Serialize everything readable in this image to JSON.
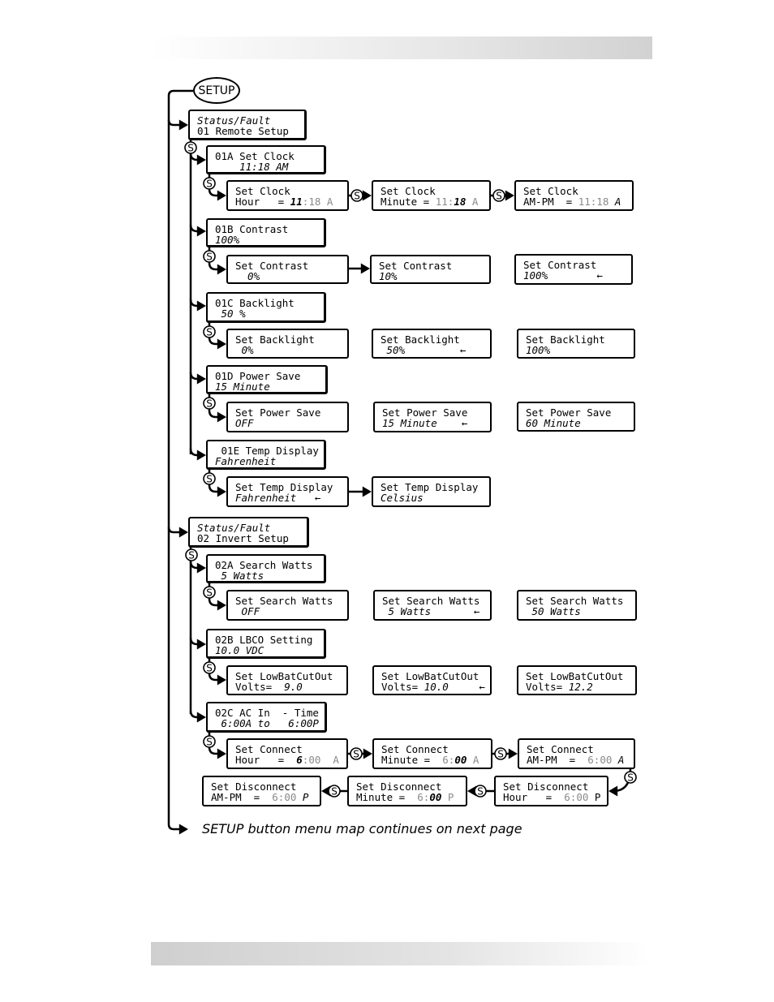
{
  "setup_button": "SETUP",
  "s_label": "S",
  "footer_note": "SETUP button menu map continues on next page",
  "boxes": {
    "status1": [
      [
        [
          "Status/Fault",
          "i"
        ]
      ],
      [
        [
          "01 Remote Setup",
          ""
        ]
      ]
    ],
    "b01A": [
      [
        [
          "01A Set Clock",
          ""
        ]
      ],
      [
        [
          "    11:18 AM",
          "i"
        ]
      ]
    ],
    "clk1": [
      [
        [
          "Set Clock",
          ""
        ]
      ],
      [
        [
          "Hour   = ",
          ""
        ],
        [
          "11",
          "ib"
        ],
        [
          ":18 A",
          "g"
        ]
      ]
    ],
    "clk2": [
      [
        [
          "Set Clock",
          ""
        ]
      ],
      [
        [
          "Minute = ",
          ""
        ],
        [
          "11:",
          "g"
        ],
        [
          "18",
          "ib"
        ],
        [
          " A",
          "g"
        ]
      ]
    ],
    "clk3": [
      [
        [
          "Set Clock",
          ""
        ]
      ],
      [
        [
          "AM-PM  = ",
          ""
        ],
        [
          "11:18 ",
          "g"
        ],
        [
          "A",
          "i"
        ]
      ]
    ],
    "b01B": [
      [
        [
          "01B Contrast",
          ""
        ]
      ],
      [
        [
          "100%",
          "i"
        ]
      ]
    ],
    "con1": [
      [
        [
          "Set Contrast",
          ""
        ]
      ],
      [
        [
          "  0%",
          "i"
        ]
      ]
    ],
    "con2": [
      [
        [
          "Set Contrast",
          ""
        ]
      ],
      [
        [
          "10%",
          "i"
        ]
      ]
    ],
    "con3": [
      [
        [
          "Set Contrast",
          ""
        ]
      ],
      [
        [
          "100%",
          "i"
        ],
        [
          "        ←",
          ""
        ]
      ]
    ],
    "b01C": [
      [
        [
          "01C Backlight",
          ""
        ]
      ],
      [
        [
          " 50 %",
          "i"
        ]
      ]
    ],
    "bl1": [
      [
        [
          "Set Backlight",
          ""
        ]
      ],
      [
        [
          " 0%",
          "i"
        ]
      ]
    ],
    "bl2": [
      [
        [
          "Set Backlight",
          ""
        ]
      ],
      [
        [
          " 50%",
          "i"
        ],
        [
          "         ←",
          ""
        ]
      ]
    ],
    "bl3": [
      [
        [
          "Set Backlight",
          ""
        ]
      ],
      [
        [
          "100%",
          "i"
        ]
      ]
    ],
    "b01D": [
      [
        [
          "01D Power Save",
          ""
        ]
      ],
      [
        [
          "15 Minute",
          "i"
        ]
      ]
    ],
    "ps1": [
      [
        [
          "Set Power Save",
          ""
        ]
      ],
      [
        [
          "OFF",
          "i"
        ]
      ]
    ],
    "ps2": [
      [
        [
          "Set Power Save",
          ""
        ]
      ],
      [
        [
          "15 Minute",
          "i"
        ],
        [
          "    ←",
          ""
        ]
      ]
    ],
    "ps3": [
      [
        [
          "Set Power Save",
          ""
        ]
      ],
      [
        [
          "60 Minute",
          "i"
        ]
      ]
    ],
    "b01E": [
      [
        [
          " 01E Temp Display",
          ""
        ]
      ],
      [
        [
          "Fahrenheit",
          "i"
        ]
      ]
    ],
    "td1": [
      [
        [
          "Set Temp Display",
          ""
        ]
      ],
      [
        [
          "Fahrenheit",
          "i"
        ],
        [
          "   ←",
          ""
        ]
      ]
    ],
    "td2": [
      [
        [
          "Set Temp Display",
          ""
        ]
      ],
      [
        [
          "Celsius",
          "i"
        ]
      ]
    ],
    "status2": [
      [
        [
          "Status/Fault",
          "i"
        ]
      ],
      [
        [
          "02 Invert Setup",
          ""
        ]
      ]
    ],
    "b02A": [
      [
        [
          "02A Search Watts",
          ""
        ]
      ],
      [
        [
          " 5 Watts",
          "i"
        ]
      ]
    ],
    "sw1": [
      [
        [
          "Set Search Watts",
          ""
        ]
      ],
      [
        [
          " OFF",
          "i"
        ]
      ]
    ],
    "sw2": [
      [
        [
          "Set Search Watts",
          ""
        ]
      ],
      [
        [
          " 5 Watts",
          "i"
        ],
        [
          "       ←",
          ""
        ]
      ]
    ],
    "sw3": [
      [
        [
          "Set Search Watts",
          ""
        ]
      ],
      [
        [
          " 50 Watts",
          "i"
        ]
      ]
    ],
    "b02B": [
      [
        [
          "02B LBCO Setting",
          ""
        ]
      ],
      [
        [
          "10.0 VDC",
          "i"
        ]
      ]
    ],
    "lb1": [
      [
        [
          "Set LowBatCutOut",
          ""
        ]
      ],
      [
        [
          "Volts=  ",
          ""
        ],
        [
          "9.0",
          "i"
        ]
      ]
    ],
    "lb2": [
      [
        [
          "Set LowBatCutOut",
          ""
        ]
      ],
      [
        [
          "Volts= ",
          ""
        ],
        [
          "10.0",
          "i"
        ],
        [
          "     ←",
          ""
        ]
      ]
    ],
    "lb3": [
      [
        [
          "Set LowBatCutOut",
          ""
        ]
      ],
      [
        [
          "Volts= ",
          ""
        ],
        [
          "12.2",
          "i"
        ]
      ]
    ],
    "b02C": [
      [
        [
          "02C AC In  - Time",
          ""
        ]
      ],
      [
        [
          " 6:00A to   6:00P",
          "i"
        ]
      ]
    ],
    "cn1": [
      [
        [
          "Set Connect",
          ""
        ]
      ],
      [
        [
          "Hour   =  ",
          ""
        ],
        [
          "6",
          "ib"
        ],
        [
          ":00  A",
          "g"
        ]
      ]
    ],
    "cn2": [
      [
        [
          "Set Connect",
          ""
        ]
      ],
      [
        [
          "Minute =  ",
          ""
        ],
        [
          "6:",
          "g"
        ],
        [
          "00",
          "ib"
        ],
        [
          " A",
          "g"
        ]
      ]
    ],
    "cn3": [
      [
        [
          "Set Connect",
          ""
        ]
      ],
      [
        [
          "AM-PM  =  ",
          ""
        ],
        [
          "6:00 ",
          "g"
        ],
        [
          "A",
          "i"
        ]
      ]
    ],
    "dc1": [
      [
        [
          "Set Disconnect",
          ""
        ]
      ],
      [
        [
          "Hour   =  ",
          ""
        ],
        [
          "6:00 ",
          "g"
        ],
        [
          "P",
          ""
        ]
      ]
    ],
    "dc2": [
      [
        [
          "Set Disconnect",
          ""
        ]
      ],
      [
        [
          "Minute =  ",
          ""
        ],
        [
          "6:",
          "g"
        ],
        [
          "00",
          "ib"
        ],
        [
          " P",
          "g"
        ]
      ]
    ],
    "dc3": [
      [
        [
          "Set Disconnect",
          ""
        ]
      ],
      [
        [
          "AM-PM  =  ",
          ""
        ],
        [
          "6:00 ",
          "g"
        ],
        [
          "P",
          "i"
        ]
      ]
    ]
  }
}
